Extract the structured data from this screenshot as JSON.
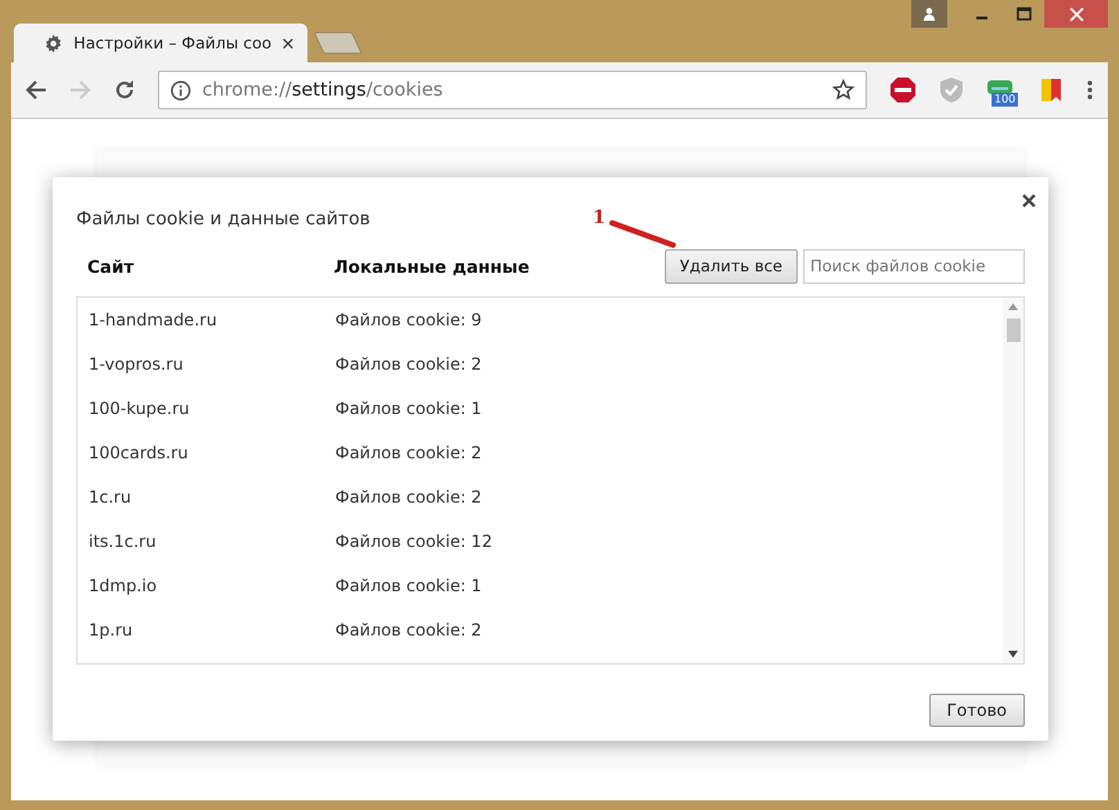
{
  "window": {
    "tab_title": "Настройки – Файлы coo"
  },
  "toolbar": {
    "address_scheme": "chrome://",
    "address_host": "settings",
    "address_path": "/cookies",
    "extension_badge": "100"
  },
  "dialog": {
    "title": "Файлы cookie и данные сайтов",
    "columns": [
      "Сайт",
      "Локальные данные"
    ],
    "delete_all_button": "Удалить все",
    "search": {
      "placeholder": "Поиск файлов cookie"
    },
    "rows": [
      {
        "site": "1-handmade.ru",
        "data": "Файлов cookie: 9"
      },
      {
        "site": "1-vopros.ru",
        "data": "Файлов cookie: 2"
      },
      {
        "site": "100-kupe.ru",
        "data": "Файлов cookie: 1"
      },
      {
        "site": "100cards.ru",
        "data": "Файлов cookie: 2"
      },
      {
        "site": "1c.ru",
        "data": "Файлов cookie: 2"
      },
      {
        "site": "its.1c.ru",
        "data": "Файлов cookie: 12"
      },
      {
        "site": "1dmp.io",
        "data": "Файлов cookie: 1"
      },
      {
        "site": "1p.ru",
        "data": "Файлов cookie: 2"
      }
    ],
    "done_button": "Готово"
  },
  "annotation": {
    "label": "1"
  }
}
